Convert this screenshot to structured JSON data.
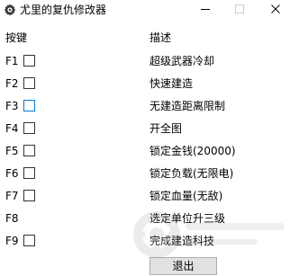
{
  "window": {
    "title": "尤里的复仇修改器"
  },
  "columns": {
    "hotkey_header": "按键",
    "desc_header": "描述"
  },
  "rows": [
    {
      "key": "F1",
      "desc": "超级武器冷却",
      "has_checkbox": true
    },
    {
      "key": "F2",
      "desc": "快速建造",
      "has_checkbox": true
    },
    {
      "key": "F3",
      "desc": "无建造距离限制",
      "has_checkbox": true
    },
    {
      "key": "F4",
      "desc": "开全图",
      "has_checkbox": true
    },
    {
      "key": "F5",
      "desc": "锁定金钱(20000)",
      "has_checkbox": true
    },
    {
      "key": "F6",
      "desc": "锁定负载(无限电)",
      "has_checkbox": true
    },
    {
      "key": "F7",
      "desc": "锁定血量(无敌)",
      "has_checkbox": true
    },
    {
      "key": "F8",
      "desc": "选定单位升三级",
      "has_checkbox": false
    },
    {
      "key": "F9",
      "desc": "完成建造科技",
      "has_checkbox": true
    }
  ],
  "buttons": {
    "exit": "退出"
  },
  "icons": {
    "app": "gear-icon",
    "minimize": "minimize-icon",
    "maximize": "maximize-icon",
    "close": "close-icon"
  },
  "colors": {
    "focus_checkbox_border": "#0078d7",
    "button_face": "#e1e1e1"
  }
}
